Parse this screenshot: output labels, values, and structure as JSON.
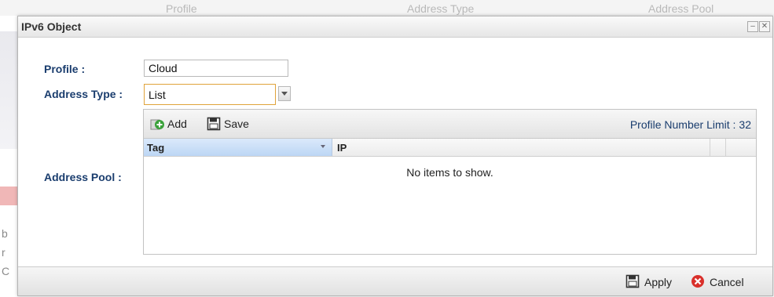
{
  "background": {
    "columns": [
      "Profile",
      "Address Type",
      "Address Pool"
    ],
    "side_letters": [
      "b",
      "r",
      "C"
    ]
  },
  "dialog": {
    "title": "IPv6 Object",
    "minimize_symbol": "–",
    "close_symbol": "✕"
  },
  "form": {
    "profile_label": "Profile :",
    "profile_value": "Cloud",
    "address_type_label": "Address Type :",
    "address_type_value": "List",
    "address_pool_label": "Address Pool :"
  },
  "pool": {
    "add_label": "Add",
    "save_label": "Save",
    "limit_label": "Profile Number Limit :",
    "limit_value": "32",
    "columns": [
      "Tag",
      "IP"
    ],
    "empty_text": "No items to show."
  },
  "footer": {
    "apply_label": "Apply",
    "cancel_label": "Cancel"
  },
  "icons": {
    "add": "add-icon",
    "save": "save-icon",
    "apply": "save-icon",
    "cancel": "cancel-icon",
    "dropdown": "chevron-down-icon",
    "sort": "sort-down-icon"
  },
  "colors": {
    "label": "#1a3d6e",
    "select_border": "#e0a33a",
    "tag_header": "#c9def7",
    "cancel": "#d9302b",
    "add": "#3aa13a"
  }
}
